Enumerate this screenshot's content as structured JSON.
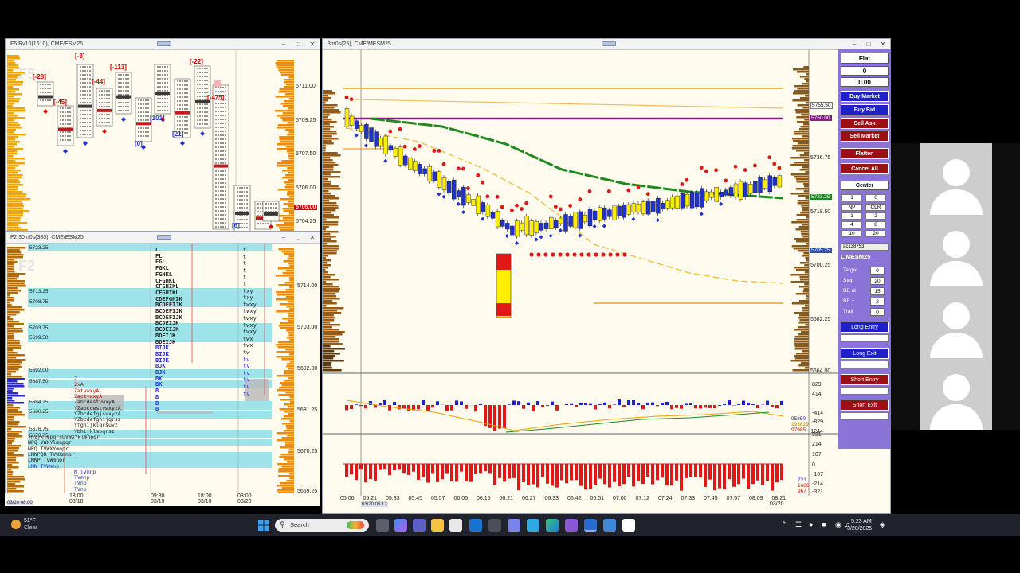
{
  "window_f5": {
    "title": "F5 Rv10(1610), CME/ESM25",
    "watermark": "F5",
    "price_labels": [
      "5711.00",
      "5709.25",
      "5707.50",
      "5706.00",
      "5704.25"
    ],
    "current_price": "5705.00",
    "delta_labels": [
      "[-28]",
      "[-45]",
      "[-3]",
      "[-44]",
      "[-113]",
      "[0]",
      "[101]",
      "[21]",
      "[-22]",
      "[-475]",
      "[6]"
    ]
  },
  "window_f2": {
    "title": "F2 30m0s(385), CME/ESM25",
    "watermark": "F2",
    "level_labels": [
      "5723.25",
      "5713.25",
      "5708.75",
      "5703.75",
      "5699.50",
      "5692.00",
      "5687.50",
      "5684.25",
      "5680.25",
      "5676.75",
      "5673.75"
    ],
    "price_axis": [
      "5714.00",
      "5703.00",
      "5692.00",
      "5681.25",
      "5670.25",
      "5659.25"
    ],
    "time_axis": [
      {
        "time": "18:00",
        "date": "03/18"
      },
      {
        "time": "09:30",
        "date": "03/19"
      },
      {
        "time": "18:00",
        "date": "03/19"
      },
      {
        "time": "03:00",
        "date": "03/20"
      }
    ],
    "start_date": "03/20 08:00",
    "profile_rows_left": [
      "L",
      "FL",
      "FGL",
      "FGKL",
      "FGHKL",
      "CFGHKL",
      "CFGHIKL",
      "CFGHIKL",
      "CDEFGHIK",
      "BCDEFIJK",
      "BCDEFIJK",
      "BCDEFIJK",
      "BCDEIJK",
      "BCDEIJK",
      "BDEIJK",
      "BDEIJK",
      "BIJK",
      "BIJK",
      "BIJK",
      "BJK",
      "BJK",
      "BK",
      "BK",
      "B",
      "B",
      "B",
      "B"
    ],
    "profile_rows_right": [
      "t",
      "t",
      "t",
      "t",
      "t",
      "t",
      "txy",
      "txy",
      "twxy",
      "twxy",
      "twxy",
      "twxy",
      "twxy",
      "twx",
      "twx",
      "tw",
      "tv",
      "tv",
      "tv",
      "tv",
      "tv",
      "tv"
    ],
    "profile_rows_lower": [
      "Z",
      "ZxA",
      "ZatvwxyA",
      "ZactvwxyA",
      "ZabcdestvwxyA",
      "YZabcdestvwxyzA",
      "YZbcdefgjsvxyzA",
      "YZbcdefghijqrsz",
      "Yfghijklqrsuvz",
      "Ybhijklmpqrsz",
      "YhijklmpqrsUVWXYklmnpqr",
      "NPQ VWXYlmnpqr",
      "NPQ TVWXYmnpr",
      "LMNPQR TVWXmnpr",
      "LMNP TVWmnpr",
      "LMN TVWmnp",
      "N TVmnp",
      "TVmnp",
      "TVnp",
      "TVnp"
    ]
  },
  "window_main": {
    "title": "3m0s(25), CME/MESM25",
    "price_axis": [
      "5736.75",
      "5718.50",
      "5700.25",
      "5682.25",
      "5664.00"
    ],
    "price_tags": [
      {
        "value": "5755.50",
        "bg": "#ffffff",
        "fg": "#000000"
      },
      {
        "value": "5750.00",
        "bg": "#8b1a8b",
        "fg": "#ffffff"
      },
      {
        "value": "5723.25",
        "bg": "#1f8b1f",
        "fg": "#ffffff"
      },
      {
        "value": "5705.25",
        "bg": "#2f4fa8",
        "fg": "#ffffff"
      }
    ],
    "time_axis": [
      "05:06",
      "05:21",
      "05:33",
      "05:45",
      "05:57",
      "06:06",
      "06:15",
      "06:21",
      "06:27",
      "06:33",
      "06:42",
      "06:51",
      "07:00",
      "07:12",
      "07:24",
      "07:33",
      "07:45",
      "07:57",
      "08:09",
      "08:21"
    ],
    "time_axis_dates": [
      "03/20"
    ],
    "start_time_label": "03/20 05:12",
    "delta_axis": [
      "829",
      "414",
      "-414",
      "-829",
      "-1244"
    ],
    "cum_delta": [
      "95850",
      "193829",
      "97985"
    ],
    "volume_axis": [
      "321",
      "214",
      "107",
      "0",
      "-107",
      "-214",
      "-321"
    ],
    "volume_labels": [
      "721",
      "1686",
      "967"
    ]
  },
  "order_panel": {
    "position": "Flat",
    "qty": "0",
    "pnl": "0.00",
    "buy_market": "Buy Market",
    "buy_bid": "Buy Bid",
    "sell_ask": "Sell Ask",
    "sell_market": "Sell Market",
    "flatten": "Flatten",
    "cancel_all": "Cancel All",
    "center": "Center",
    "qty_value": "1",
    "qty_zero": "0",
    "grid": [
      [
        "NP",
        "CLR"
      ],
      [
        "1",
        "2"
      ],
      [
        "4",
        "8"
      ],
      [
        "10",
        "20"
      ]
    ],
    "account": "ac138753",
    "instrument": "L MESM25",
    "target_label": "Target",
    "target_value": "0",
    "stop_label": "Stop",
    "stop_value": "20",
    "be_at_label": "BE at",
    "be_at_value": "15",
    "be_plus_label": "BE +",
    "be_plus_value": "2",
    "trail_label": "Trail",
    "trail_value": "0",
    "long_entry": "Long Entry",
    "long_exit": "Long Exit",
    "short_entry": "Short Entry",
    "short_exit": "Short Exit"
  },
  "taskbar": {
    "weather_temp": "51°F",
    "weather_desc": "Clear",
    "search_placeholder": "Search",
    "time": "5:23 AM",
    "date": "3/20/2025"
  },
  "colors": {
    "buy": "#1f20c8",
    "sell": "#9c0f12",
    "profile_orange": "#f08a00",
    "panel_purple": "#8b74d8"
  }
}
